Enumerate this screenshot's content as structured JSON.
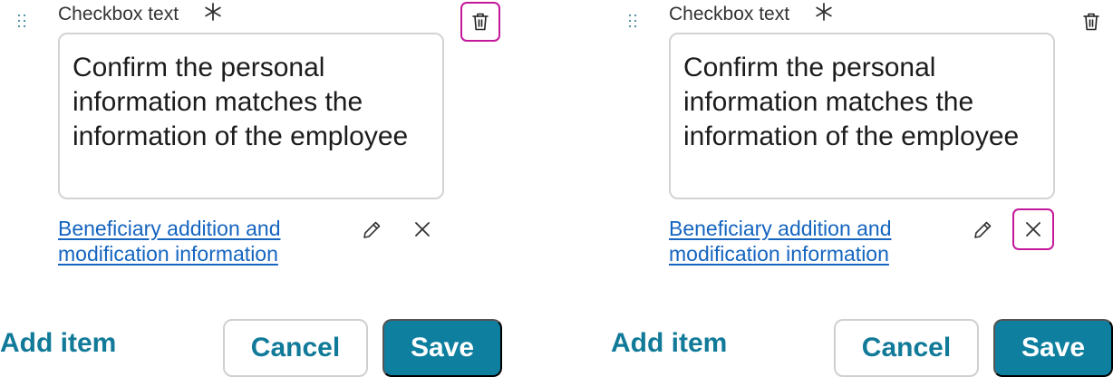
{
  "colors": {
    "accent": "#117a99",
    "primary_button": "#0f7fa0",
    "link": "#1565c0",
    "focus_ring": "#c4189a",
    "input_border": "#d3d3d3"
  },
  "panels": [
    {
      "field_label": "Checkbox text",
      "required_icon": "asterisk-icon",
      "checkbox_text": "Confirm the personal information matches the information of the employee",
      "link_text": "Beneficiary addition and modification information",
      "icons": {
        "drag": "drag-handle-icon",
        "delete": "trash-icon",
        "edit": "pencil-icon",
        "remove": "close-icon"
      },
      "focused_control": "delete",
      "add_item_label": "Add item",
      "cancel_label": "Cancel",
      "save_label": "Save"
    },
    {
      "field_label": "Checkbox text",
      "required_icon": "asterisk-icon",
      "checkbox_text": "Confirm the personal information matches the information of the employee",
      "link_text": "Beneficiary addition and modification information",
      "icons": {
        "drag": "drag-handle-icon",
        "delete": "trash-icon",
        "edit": "pencil-icon",
        "remove": "close-icon"
      },
      "focused_control": "remove",
      "add_item_label": "Add item",
      "cancel_label": "Cancel",
      "save_label": "Save"
    }
  ]
}
